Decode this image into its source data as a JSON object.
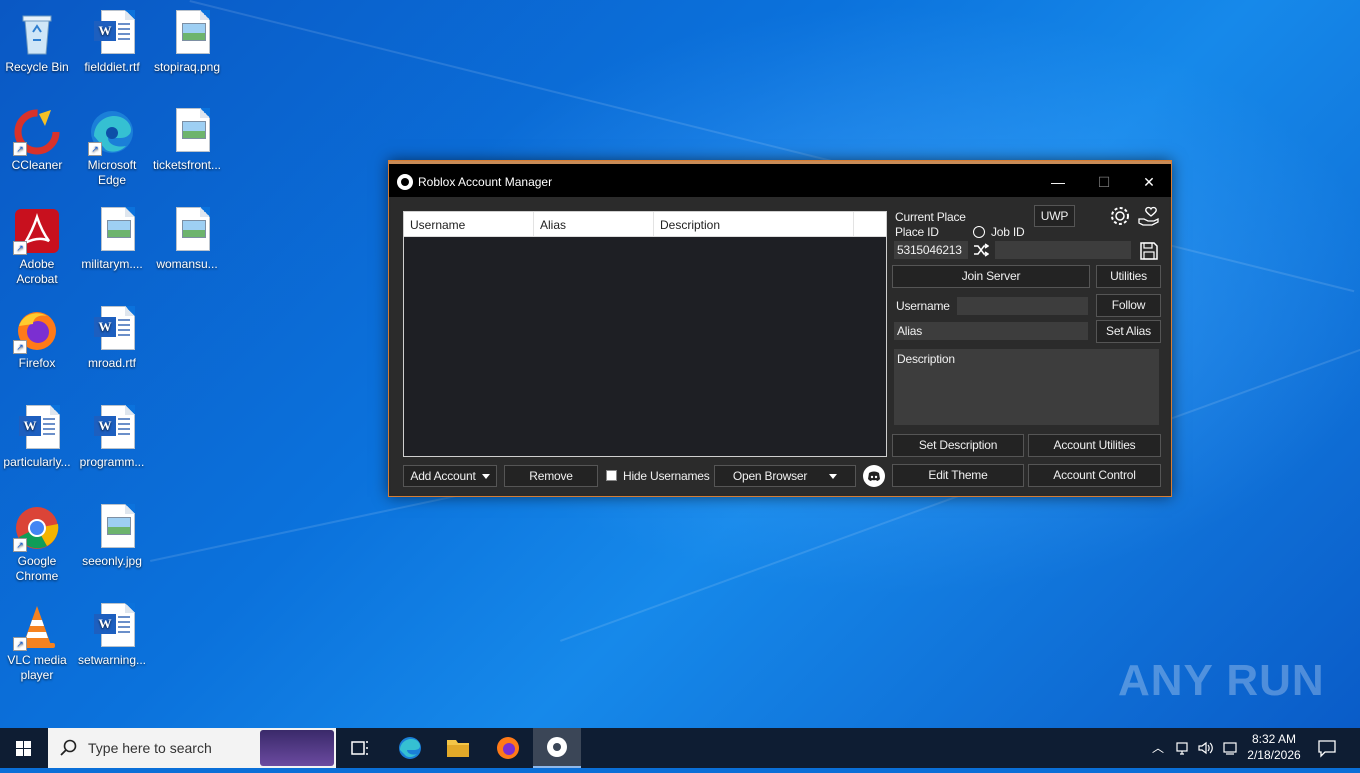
{
  "desktop": {
    "icons": [
      {
        "label": "Recycle Bin"
      },
      {
        "label": "fielddiet.rtf"
      },
      {
        "label": "stopiraq.png"
      },
      {
        "label": "CCleaner"
      },
      {
        "label": "Microsoft Edge"
      },
      {
        "label": "ticketsfront..."
      },
      {
        "label": "Adobe Acrobat"
      },
      {
        "label": "militarym...."
      },
      {
        "label": "womansu..."
      },
      {
        "label": "Firefox"
      },
      {
        "label": "mroad.rtf"
      },
      {
        "label": "particularly..."
      },
      {
        "label": "programm..."
      },
      {
        "label": "Google Chrome"
      },
      {
        "label": "seeonly.jpg"
      },
      {
        "label": "VLC media player"
      },
      {
        "label": "setwarning..."
      }
    ],
    "watermark": "ANY RUN"
  },
  "window": {
    "title": "Roblox Account Manager",
    "minimize": "—",
    "maximize": "☐",
    "close": "✕"
  },
  "accounts_list": {
    "columns": [
      "Username",
      "Alias",
      "Description"
    ],
    "rows": []
  },
  "bottom_bar": {
    "add_account": "Add Account",
    "remove": "Remove",
    "hide_usernames": "Hide Usernames",
    "open_browser": "Open Browser"
  },
  "right_panel": {
    "current_place_label": "Current Place",
    "place_id_label": "Place ID",
    "job_id_label": "Job ID",
    "uwp_button": "UWP",
    "place_id_value": "5315046213",
    "job_id_value": "",
    "join_server": "Join Server",
    "utilities": "Utilities",
    "username_label": "Username",
    "username_value": "",
    "follow": "Follow",
    "alias_placeholder": "Alias",
    "set_alias": "Set Alias",
    "description_placeholder": "Description",
    "set_description": "Set Description",
    "account_utilities": "Account Utilities",
    "edit_theme": "Edit Theme",
    "account_control": "Account Control"
  },
  "taskbar": {
    "search_placeholder": "Type here to search",
    "time": "8:32 AM",
    "date": "2/18/2026"
  }
}
